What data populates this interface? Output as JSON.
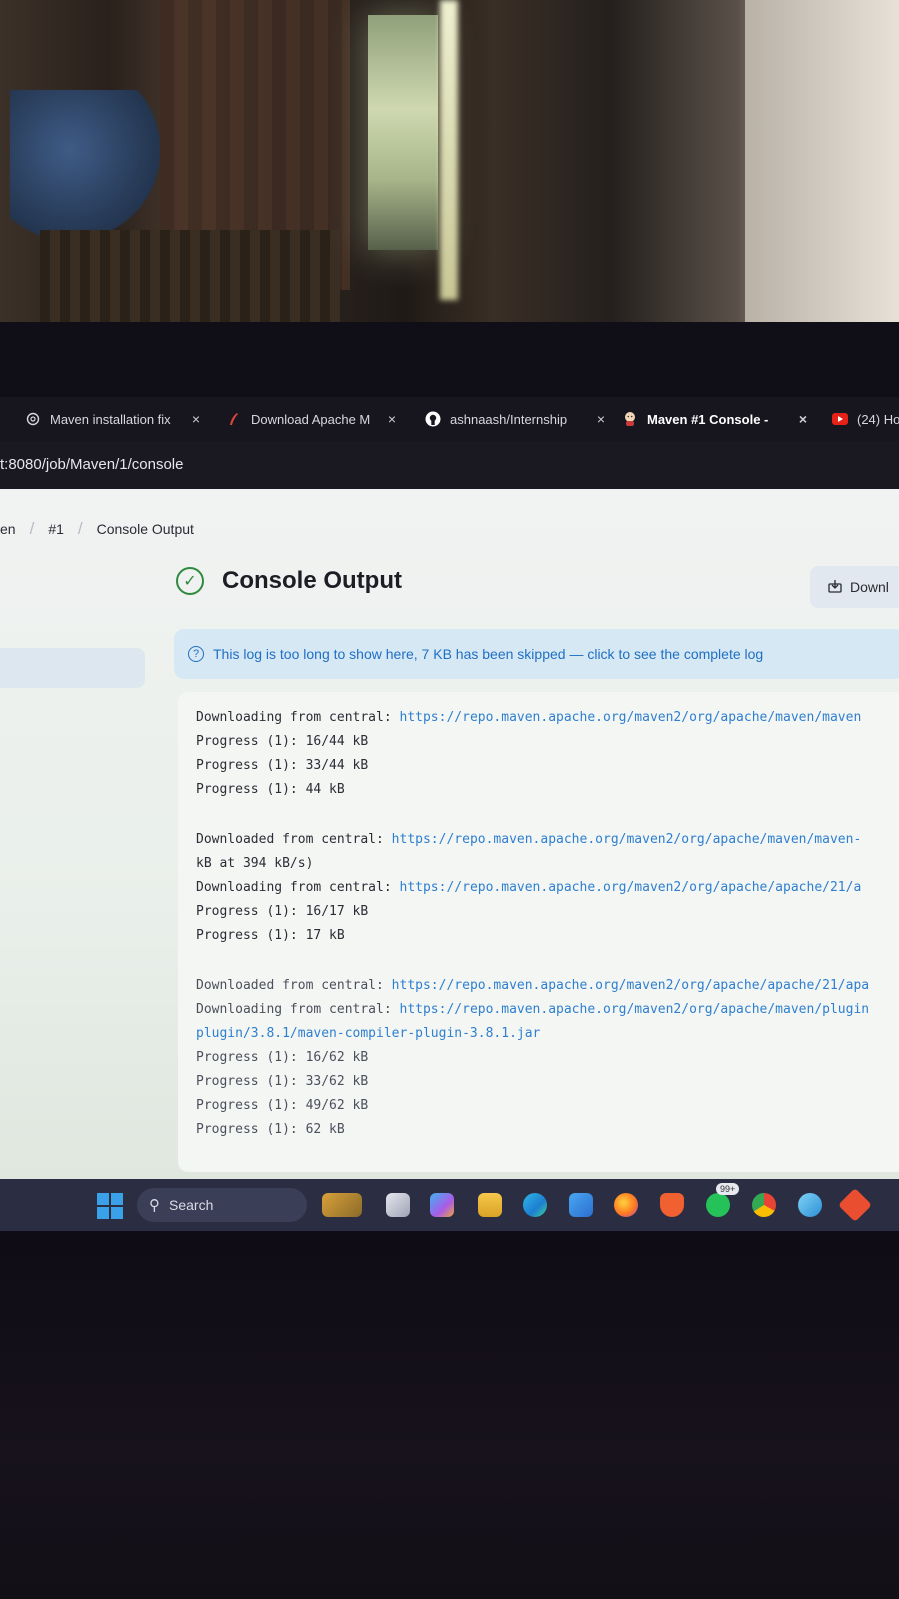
{
  "tabs": [
    {
      "label": "Maven installation fix",
      "icon": "openai-icon"
    },
    {
      "label": "Download Apache M",
      "icon": "apache-feather-icon"
    },
    {
      "label": "ashnaash/Internship",
      "icon": "github-icon"
    },
    {
      "label": "Maven #1 Console -",
      "icon": "jenkins-icon"
    },
    {
      "label": "(24) Ho",
      "icon": "youtube-icon"
    }
  ],
  "close_glyph": "×",
  "url": "t:8080/job/Maven/1/console",
  "breadcrumb": {
    "item1": "en",
    "item2": "#1",
    "item3": "Console Output",
    "separator": "/"
  },
  "page_title": "Console Output",
  "download_button": "Downl",
  "notice": "This log is too long to show here, 7 KB has been skipped — click to see the complete log",
  "console": {
    "lines": [
      {
        "prefix": "Downloading from central: ",
        "url": "https://repo.maven.apache.org/maven2/org/apache/maven/maven"
      },
      {
        "prefix": "Progress (1): 16/44 kB",
        "url": ""
      },
      {
        "prefix": "Progress (1): 33/44 kB",
        "url": ""
      },
      {
        "prefix": "Progress (1): 44 kB",
        "url": ""
      },
      {
        "prefix": "Downloaded from central: ",
        "url": "https://repo.maven.apache.org/maven2/org/apache/maven/maven-"
      },
      {
        "prefix": "kB at 394 kB/s)",
        "url": ""
      },
      {
        "prefix": "Downloading from central: ",
        "url": "https://repo.maven.apache.org/maven2/org/apache/apache/21/a"
      },
      {
        "prefix": "Progress (1): 16/17 kB",
        "url": ""
      },
      {
        "prefix": "Progress (1): 17 kB",
        "url": ""
      },
      {
        "prefix": "Downloaded from central: ",
        "url": "https://repo.maven.apache.org/maven2/org/apache/apache/21/apa"
      },
      {
        "prefix": "Downloading from central: ",
        "url": "https://repo.maven.apache.org/maven2/org/apache/maven/plugin"
      },
      {
        "prefix": "",
        "url": "plugin/3.8.1/maven-compiler-plugin-3.8.1.jar"
      },
      {
        "prefix": "Progress (1): 16/62 kB",
        "url": ""
      },
      {
        "prefix": "Progress (1): 33/62 kB",
        "url": ""
      },
      {
        "prefix": "Progress (1): 49/62 kB",
        "url": ""
      },
      {
        "prefix": "Progress (1): 62 kB",
        "url": ""
      }
    ]
  },
  "taskbar": {
    "search_label": "Search",
    "badge": "99+",
    "icons": [
      "widgets-icon",
      "task-view-icon",
      "copilot-icon",
      "file-explorer-icon",
      "edge-icon",
      "store-icon",
      "firefox-icon",
      "brave-icon",
      "whatsapp-icon",
      "chrome-icon",
      "app-icon",
      "git-icon"
    ]
  },
  "colors": {
    "link": "#2f7fd0",
    "success": "#2f8a3e",
    "notice_bg": "#d6e8f4",
    "taskbar": "#2b2e42"
  }
}
